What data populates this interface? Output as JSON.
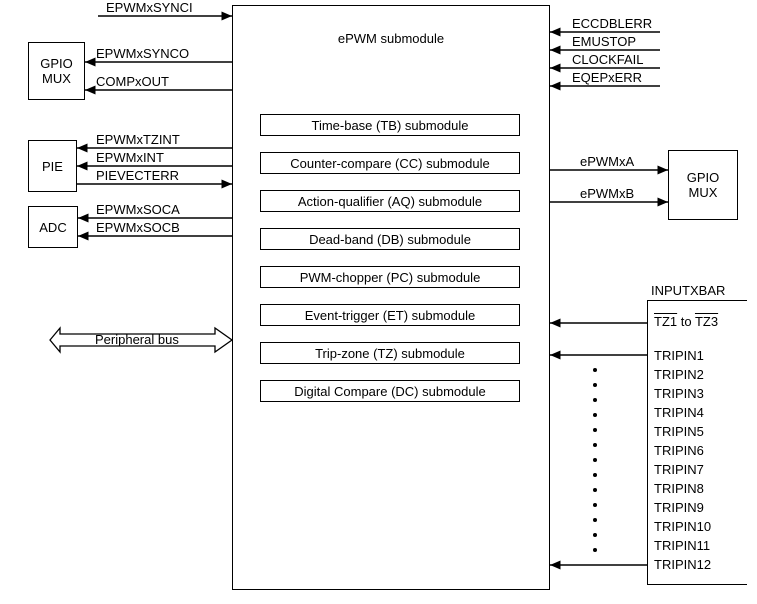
{
  "main": {
    "title": "ePWM submodule"
  },
  "left_boxes": {
    "gpio_mux": "GPIO\nMUX",
    "pie": "PIE",
    "adc": "ADC"
  },
  "right_boxes": {
    "gpio_mux": "GPIO\nMUX",
    "inputxbar": "INPUTXBAR"
  },
  "left_signals": {
    "sync_in": "EPWMxSYNCI",
    "sync_out": "EPWMxSYNCO",
    "comp_out": "COMPxOUT",
    "tzint": "EPWMxTZINT",
    "xint": "EPWMxINT",
    "pievecterr": "PIEVECTERR",
    "soca": "EPWMxSOCA",
    "socb": "EPWMxSOCB",
    "bus": "Peripheral bus"
  },
  "right_signals": {
    "eccdblerr": "ECCDBLERR",
    "emustop": "EMUSTOP",
    "clockfail": "CLOCKFAIL",
    "eqepxerr": "EQEPxERR",
    "epwma": "ePWMxA",
    "epwmb": "ePWMxB",
    "tz_range_a": "TZ1",
    "tz_range_mid": " to ",
    "tz_range_b": "TZ3"
  },
  "submodules": {
    "tb": "Time-base (TB) submodule",
    "cc": "Counter-compare (CC) submodule",
    "aq": "Action-qualifier (AQ) submodule",
    "db": "Dead-band (DB) submodule",
    "pc": "PWM-chopper (PC) submodule",
    "et": "Event-trigger (ET) submodule",
    "tz": "Trip-zone (TZ) submodule",
    "dc": "Digital Compare (DC) submodule"
  },
  "tripin": {
    "t1": "TRIPIN1",
    "t2": "TRIPIN2",
    "t3": "TRIPIN3",
    "t4": "TRIPIN4",
    "t5": "TRIPIN5",
    "t6": "TRIPIN6",
    "t7": "TRIPIN7",
    "t8": "TRIPIN8",
    "t9": "TRIPIN9",
    "t10": "TRIPIN10",
    "t11": "TRIPIN11",
    "t12": "TRIPIN12"
  }
}
